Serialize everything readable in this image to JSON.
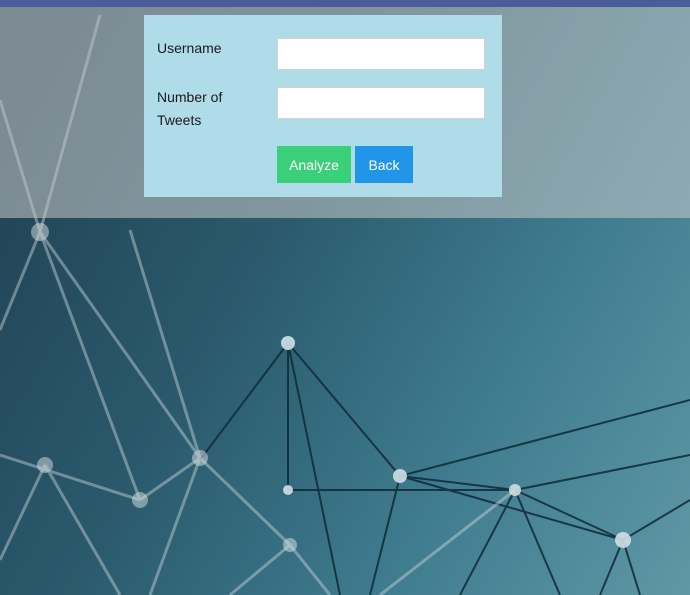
{
  "form": {
    "username_label": "Username",
    "username_value": "",
    "tweets_label": "Number of Tweets",
    "tweets_value": "",
    "analyze_label": "Analyze",
    "back_label": "Back"
  },
  "colors": {
    "top_bar": "#4a5d9a",
    "panel_background": "#b0dbe8",
    "analyze_button": "#3ad07a",
    "back_button": "#2196e8"
  }
}
